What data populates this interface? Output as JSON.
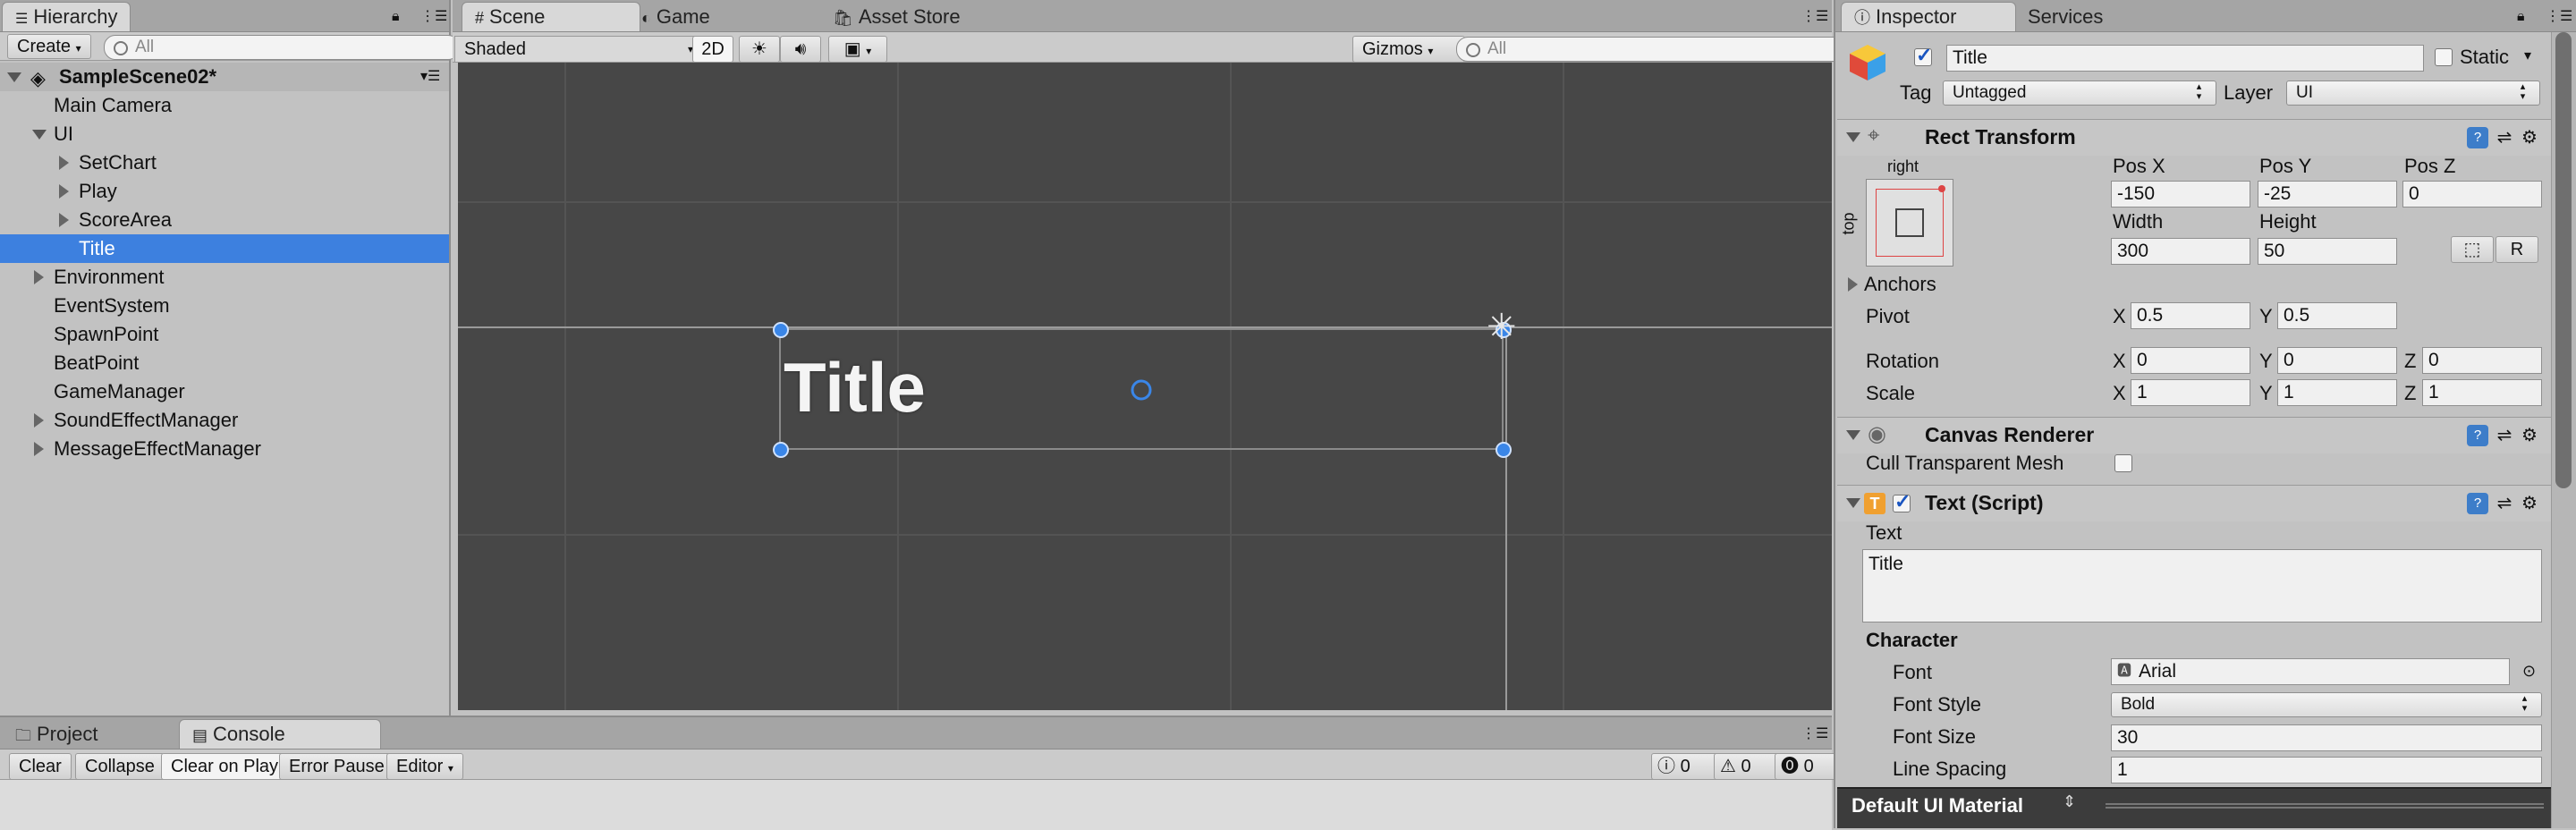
{
  "hierarchy": {
    "tab_label": "Hierarchy",
    "create_label": "Create",
    "search_placeholder": "All",
    "scene_name": "SampleScene02*",
    "items": [
      {
        "label": "Main Camera"
      },
      {
        "label": "UI"
      },
      {
        "label": "SetChart"
      },
      {
        "label": "Play"
      },
      {
        "label": "ScoreArea"
      },
      {
        "label": "Title"
      },
      {
        "label": "Environment"
      },
      {
        "label": "EventSystem"
      },
      {
        "label": "SpawnPoint"
      },
      {
        "label": "BeatPoint"
      },
      {
        "label": "GameManager"
      },
      {
        "label": "SoundEffectManager"
      },
      {
        "label": "MessageEffectManager"
      }
    ]
  },
  "scene": {
    "tabs": [
      {
        "label": "Scene"
      },
      {
        "label": "Game"
      },
      {
        "label": "Asset Store"
      }
    ],
    "shading_mode": "Shaded",
    "mode_2d_label": "2D",
    "gizmos_label": "Gizmos",
    "search_placeholder": "All",
    "title_text": "Title"
  },
  "console": {
    "tabs": [
      {
        "label": "Project"
      },
      {
        "label": "Console"
      }
    ],
    "buttons": {
      "clear": "Clear",
      "collapse": "Collapse",
      "clear_on_play": "Clear on Play",
      "error_pause": "Error Pause",
      "editor": "Editor"
    },
    "counts": {
      "info": "0",
      "warning": "0",
      "error": "0"
    }
  },
  "inspector": {
    "tabs": [
      {
        "label": "Inspector"
      },
      {
        "label": "Services"
      }
    ],
    "object_name": "Title",
    "static_label": "Static",
    "tag_label": "Tag",
    "tag_value": "Untagged",
    "layer_label": "Layer",
    "layer_value": "UI",
    "rect_transform": {
      "title": "Rect Transform",
      "anchor_h": "right",
      "anchor_v": "top",
      "pos_x_label": "Pos X",
      "pos_x": "-150",
      "pos_y_label": "Pos Y",
      "pos_y": "-25",
      "pos_z_label": "Pos Z",
      "pos_z": "0",
      "width_label": "Width",
      "width": "300",
      "height_label": "Height",
      "height": "50",
      "r_button": "R",
      "anchors_label": "Anchors",
      "pivot_label": "Pivot",
      "pivot_x": "0.5",
      "pivot_y": "0.5",
      "rotation_label": "Rotation",
      "rot_x": "0",
      "rot_y": "0",
      "rot_z": "0",
      "scale_label": "Scale",
      "scale_x": "1",
      "scale_y": "1",
      "scale_z": "1",
      "x": "X",
      "y": "Y",
      "z": "Z"
    },
    "canvas_renderer": {
      "title": "Canvas Renderer",
      "cull_label": "Cull Transparent Mesh"
    },
    "text_script": {
      "title": "Text (Script)",
      "text_label": "Text",
      "text_value": "Title",
      "character_label": "Character",
      "font_label": "Font",
      "font_value": "Arial",
      "font_style_label": "Font Style",
      "font_style_value": "Bold",
      "font_size_label": "Font Size",
      "font_size_value": "30",
      "line_spacing_label": "Line Spacing",
      "line_spacing_value": "1"
    },
    "material_label": "Default UI Material"
  },
  "colors": {
    "selection": "#3d80df",
    "scene_bg": "#474747",
    "handle": "#3a86e8"
  }
}
